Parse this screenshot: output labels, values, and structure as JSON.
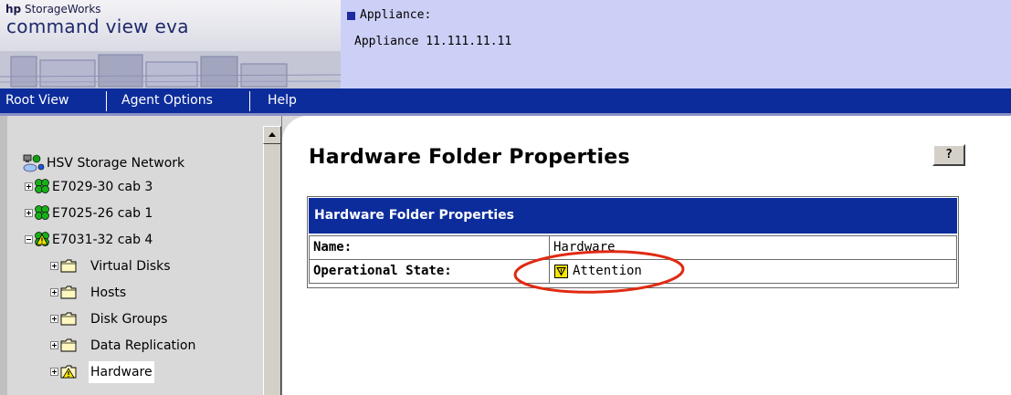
{
  "header": {
    "brand": {
      "hp": "hp",
      "storageworks": "StorageWorks"
    },
    "product_title": "command view eva",
    "appliance_label": "Appliance:",
    "appliance_value": "Appliance 11.111.11.11",
    "colors": {
      "nav": "#0d2c9c",
      "appliance_bg": "#cdd0f6"
    }
  },
  "nav": {
    "items": [
      {
        "label": "Root View"
      },
      {
        "label": "Agent Options"
      },
      {
        "label": "Help"
      }
    ]
  },
  "tree": {
    "items": [
      {
        "label": "HSV Storage Network",
        "icon": "network-icon"
      },
      {
        "label": "E7029-30 cab 3",
        "icon": "cabinet-icon",
        "expander": "plus"
      },
      {
        "label": "E7025-26 cab 1",
        "icon": "cabinet-icon",
        "expander": "plus"
      },
      {
        "label": "E7031-32 cab 4",
        "icon": "cabinet-warning-icon",
        "expander": "minus"
      },
      {
        "label": "Virtual Disks",
        "icon": "folder-icon",
        "expander": "plus"
      },
      {
        "label": "Hosts",
        "icon": "folder-icon",
        "expander": "plus"
      },
      {
        "label": "Disk Groups",
        "icon": "folder-icon",
        "expander": "plus"
      },
      {
        "label": "Data Replication",
        "icon": "folder-icon",
        "expander": "plus"
      },
      {
        "label": "Hardware",
        "icon": "folder-warning-icon",
        "expander": "plus",
        "selected": true
      }
    ]
  },
  "main": {
    "title": "Hardware Folder Properties",
    "help_label": "?",
    "table": {
      "header": "Hardware Folder Properties",
      "rows": [
        {
          "name": "Name:",
          "value": "Hardware"
        },
        {
          "name": "Operational State:",
          "value": "Attention",
          "status_icon": "attention-icon"
        }
      ]
    }
  }
}
